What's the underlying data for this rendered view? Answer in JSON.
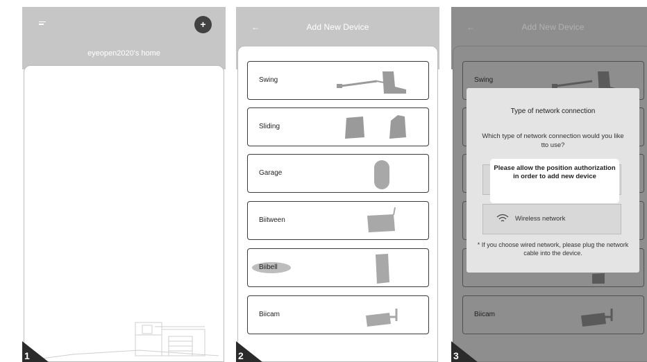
{
  "screen1": {
    "step": "1",
    "home_title": "eyeopen2020's home",
    "add_symbol": "+",
    "menu_icon": "menu-icon"
  },
  "screen2": {
    "step": "2",
    "back_arrow": "←",
    "title": "Add New Device",
    "devices": [
      {
        "label": "Swing",
        "icon": "swing-gate-icon"
      },
      {
        "label": "Sliding",
        "icon": "sliding-gate-icon"
      },
      {
        "label": "Garage",
        "icon": "garage-opener-icon"
      },
      {
        "label": "Biitween",
        "icon": "biitween-device-icon"
      },
      {
        "label": "Biibell",
        "icon": "doorbell-icon"
      },
      {
        "label": "Biicam",
        "icon": "camera-icon"
      }
    ]
  },
  "screen3": {
    "step": "3",
    "back_arrow": "←",
    "title": "Add New Device",
    "devices": [
      {
        "label": "Swing"
      },
      {
        "label": "Biicam"
      }
    ],
    "dialog": {
      "title": "Type of network connection",
      "body": "Which type of network connection would you like tto use?",
      "wireless_label": "Wireless network",
      "footnote": "* If you choose wired network, please plug the network cable into the device."
    },
    "tooltip": "Please allow the position authorization in order to add new device"
  },
  "colors": {
    "header": "#c6c6c6",
    "overlay_header": "#8e8e8e",
    "dialog": "#e4e4e4",
    "step_badge": "#2b2b2b"
  }
}
